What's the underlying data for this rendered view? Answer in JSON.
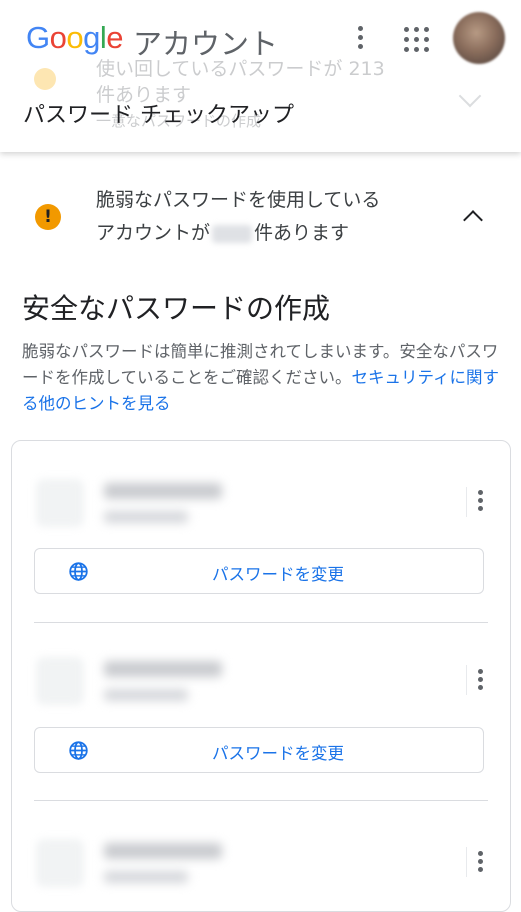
{
  "header": {
    "logo_letters": [
      "G",
      "o",
      "o",
      "g",
      "l",
      "e"
    ],
    "logo_colors": [
      "#4285F4",
      "#EA4335",
      "#FBBC05",
      "#4285F4",
      "#34A853",
      "#EA4335"
    ],
    "product_name": "アカウント",
    "page_title": "パスワード チェックアップ",
    "more_icon": "more-vert-icon",
    "apps_icon": "apps-grid-icon",
    "avatar": "account-avatar"
  },
  "behind_content": {
    "line1": "使い回しているパスワードが 213",
    "line2": "件あります",
    "line3": "一意なパスワードの作成"
  },
  "weak_panel": {
    "text_before": "脆弱なパスワードを使用している",
    "text_line2_start": "アカウントが",
    "text_line2_end": "件あります",
    "warning_color": "#F29900",
    "icon": "warning-icon",
    "toggle_icon": "chevron-up-icon"
  },
  "section": {
    "title": "安全なパスワードの作成",
    "description": "脆弱なパスワードは簡単に推測されてしまいます。安全なパスワードを作成していることをご確認ください。",
    "link_text": "セキュリティに関する他のヒントを見る"
  },
  "items": [
    {
      "button_label": "パスワードを変更",
      "icon": "globe-icon"
    },
    {
      "button_label": "パスワードを変更",
      "icon": "globe-icon"
    },
    {
      "button_label": "",
      "icon": "globe-icon"
    }
  ],
  "colors": {
    "accent": "#1A73E8",
    "text": "#202124",
    "secondary_text": "#5F6368",
    "border": "#DADCE0"
  }
}
